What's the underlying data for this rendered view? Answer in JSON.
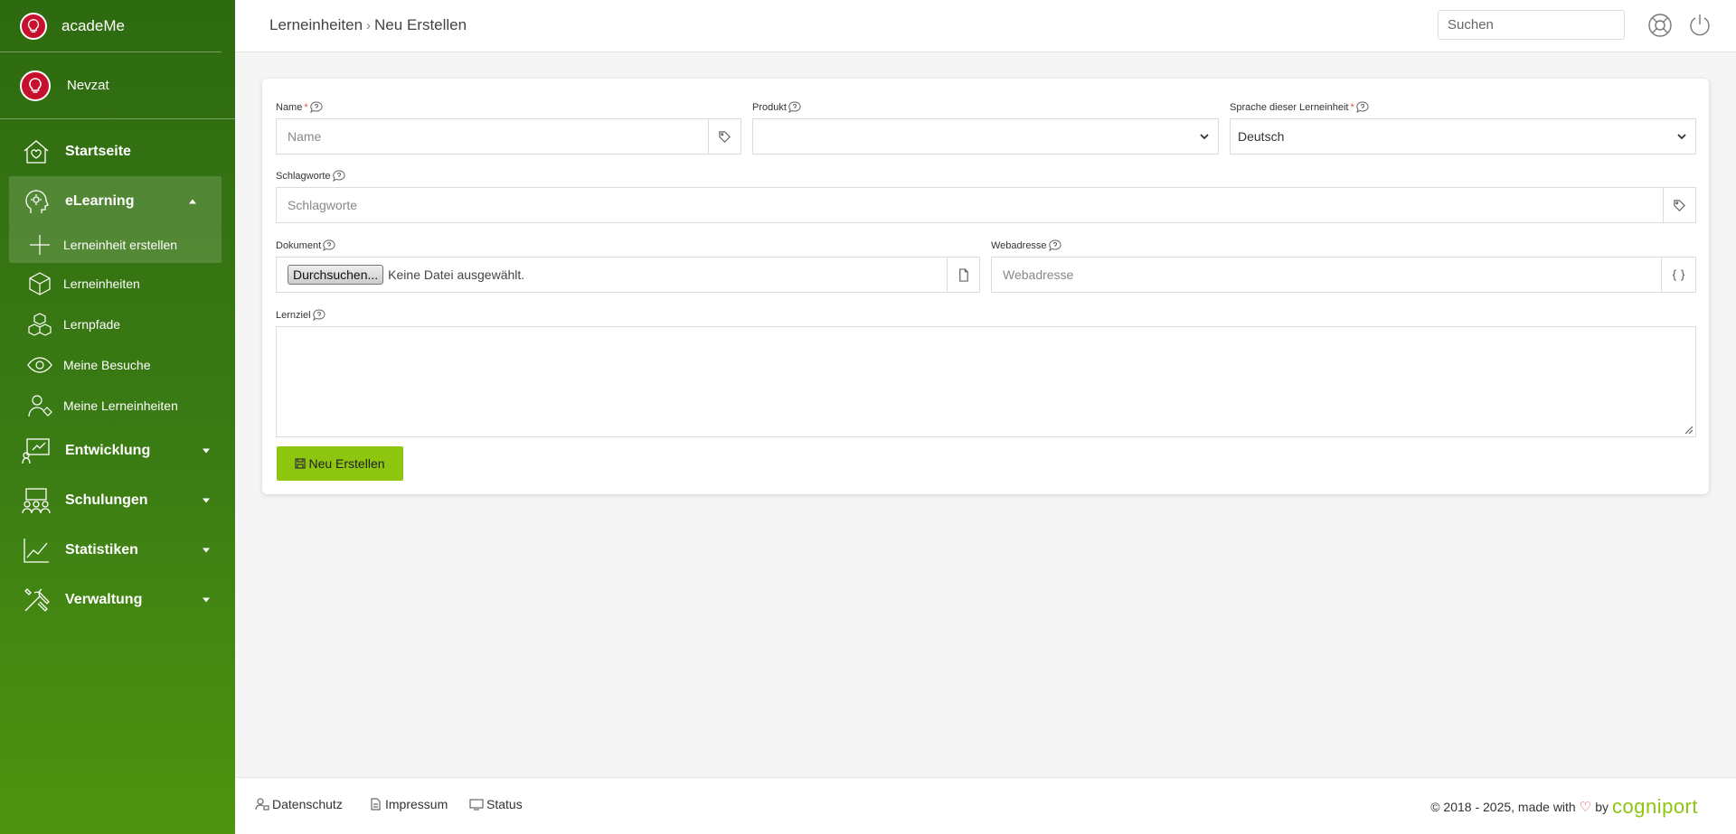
{
  "app": {
    "name": "acadeMe"
  },
  "user": {
    "name": "Nevzat"
  },
  "sidebar": {
    "items": [
      {
        "label": "Startseite",
        "icon": "home-heart-icon"
      },
      {
        "label": "eLearning",
        "icon": "head-gear-icon",
        "expanded": true,
        "children": [
          {
            "label": "Lerneinheit erstellen",
            "icon": "plus-icon",
            "active": true
          },
          {
            "label": "Lerneinheiten",
            "icon": "cube-icon"
          },
          {
            "label": "Lernpfade",
            "icon": "cubes-icon"
          },
          {
            "label": "Meine Besuche",
            "icon": "eye-icon"
          },
          {
            "label": "Meine Lerneinheiten",
            "icon": "user-tag-icon"
          }
        ]
      },
      {
        "label": "Entwicklung",
        "icon": "presentation-growth-icon"
      },
      {
        "label": "Schulungen",
        "icon": "group-icon"
      },
      {
        "label": "Statistiken",
        "icon": "line-chart-icon"
      },
      {
        "label": "Verwaltung",
        "icon": "tools-icon"
      }
    ]
  },
  "header": {
    "breadcrumb": [
      "Lerneinheiten",
      "Neu Erstellen"
    ],
    "search_placeholder": "Suchen"
  },
  "form": {
    "name": {
      "label": "Name",
      "placeholder": "Name",
      "required_mark": "*"
    },
    "product": {
      "label": "Produkt",
      "value": ""
    },
    "language": {
      "label": "Sprache dieser Lerneinheit",
      "value": "Deutsch",
      "required_mark": "*"
    },
    "keywords": {
      "label": "Schlagworte",
      "placeholder": "Schlagworte"
    },
    "document": {
      "label": "Dokument",
      "button": "Durchsuchen...",
      "status": "Keine Datei ausgewählt."
    },
    "url": {
      "label": "Webadresse",
      "placeholder": "Webadresse"
    },
    "goal": {
      "label": "Lernziel",
      "value": ""
    },
    "submit_label": "Neu Erstellen"
  },
  "footer": {
    "links": [
      "Datenschutz",
      "Impressum",
      "Status"
    ],
    "copyright": "2018 - 2025, made with",
    "by": "by",
    "brand": "cogniport"
  },
  "colors": {
    "sidebar_top": "#2e6a10",
    "sidebar_bottom": "#4f940f",
    "accent": "#8dc50f",
    "required": "#d9534f",
    "logo": "#c8102e"
  }
}
